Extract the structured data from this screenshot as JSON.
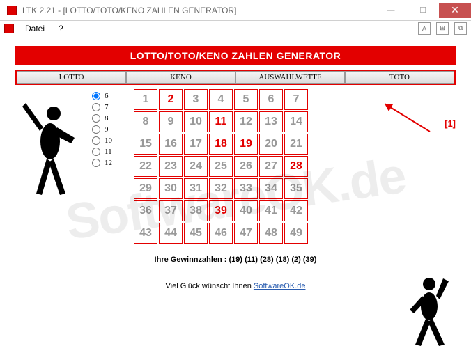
{
  "window": {
    "title": "LTK 2.21 - [LOTTO/TOTO/KENO ZAHLEN GENERATOR]"
  },
  "menu": {
    "file": "Datei",
    "help": "?"
  },
  "header": "LOTTO/TOTO/KENO ZAHLEN GENERATOR",
  "tabs": {
    "lotto": "LOTTO",
    "keno": "KENO",
    "auswahl": "AUSWAHLWETTE",
    "toto": "TOTO"
  },
  "radios": {
    "r6": "6",
    "r7": "7",
    "r8": "8",
    "r9": "9",
    "r10": "10",
    "r11": "11",
    "r12": "12",
    "selected": "6"
  },
  "grid": {
    "cells": [
      1,
      2,
      3,
      4,
      5,
      6,
      7,
      8,
      9,
      10,
      11,
      12,
      13,
      14,
      15,
      16,
      17,
      18,
      19,
      20,
      21,
      22,
      23,
      24,
      25,
      26,
      27,
      28,
      29,
      30,
      31,
      32,
      33,
      34,
      35,
      36,
      37,
      38,
      39,
      40,
      41,
      42,
      43,
      44,
      45,
      46,
      47,
      48,
      49
    ],
    "selected": [
      2,
      11,
      18,
      19,
      28,
      39
    ]
  },
  "annotation": "[1]",
  "result": {
    "label": "Ihre Gewinnzahlen : (19) (11) (28) (18) (2) (39)"
  },
  "footer": {
    "text": "Viel Glück wünscht Ihnen ",
    "link": "SoftwareOK.de"
  },
  "watermark": "SoftwareOK.de"
}
